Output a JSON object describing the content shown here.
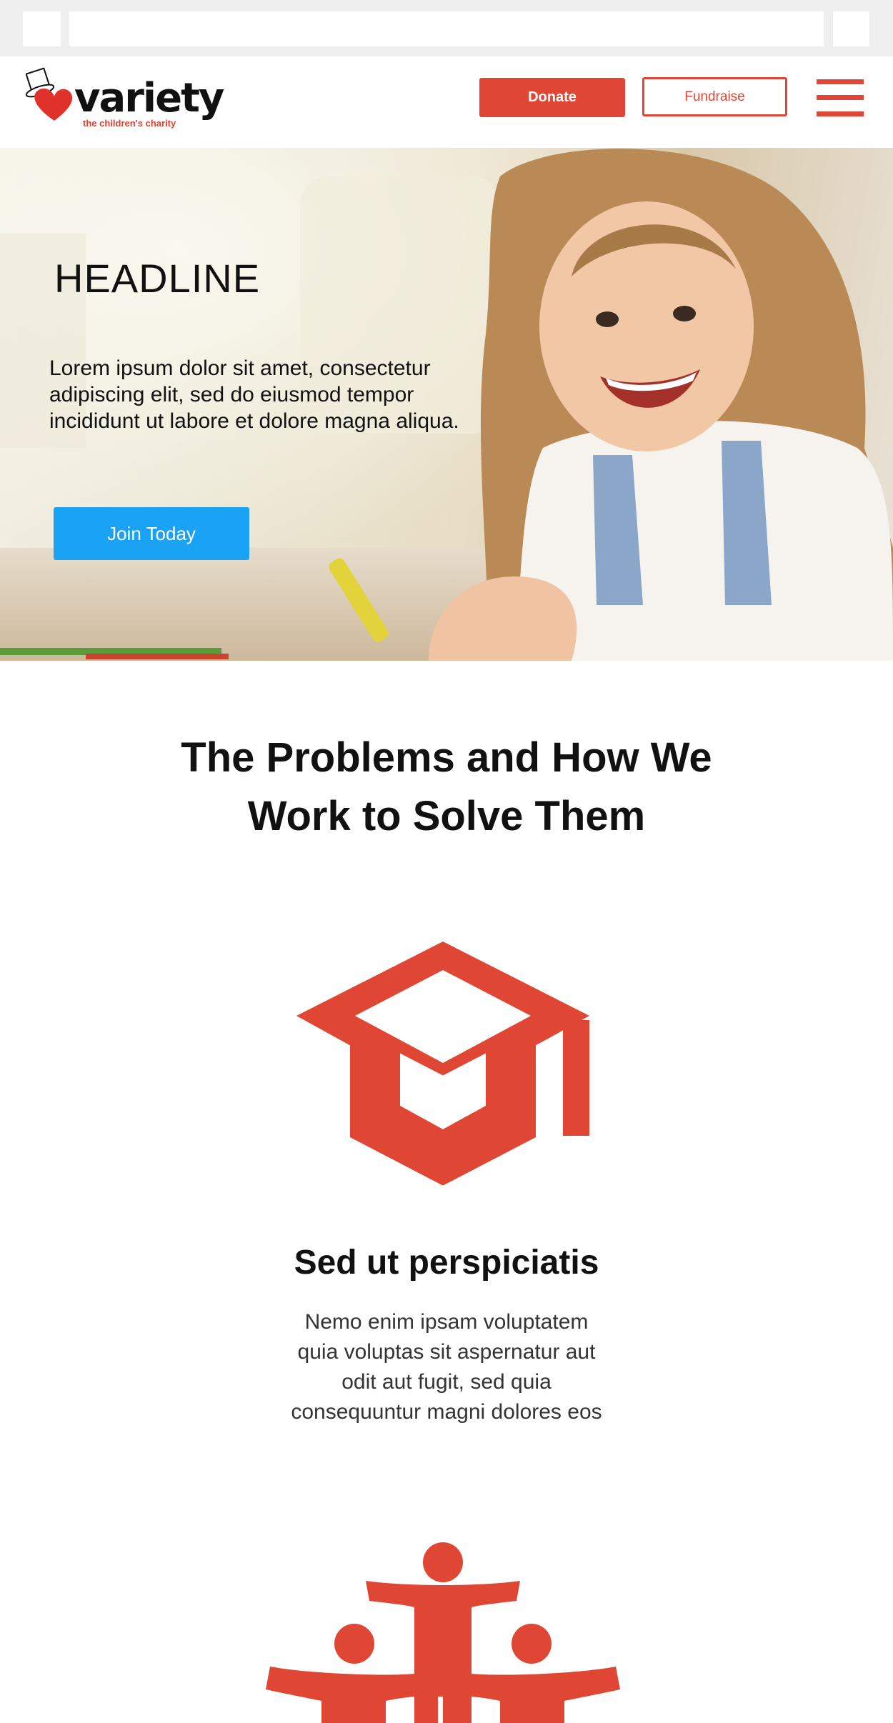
{
  "browser": {
    "url": ""
  },
  "header": {
    "logo_word": "variety",
    "logo_tagline": "the children's charity",
    "donate_label": "Donate",
    "fundraise_label": "Fundraise"
  },
  "hero": {
    "headline": "HEADLINE",
    "body": "Lorem ipsum dolor sit amet, consectetur adipiscing elit, sed do eiusmod tempor incididunt ut labore et dolore magna aliqua.",
    "cta_label": "Join Today"
  },
  "section": {
    "title": "The Problems and How We Work to Solve Them",
    "cards": [
      {
        "icon": "graduation-cap-icon",
        "title": "Sed ut perspiciatis",
        "body": "Nemo enim ipsam voluptatem quia voluptas sit aspernatur aut odit aut fugit, sed quia consequuntur magni dolores eos"
      },
      {
        "icon": "group-people-icon"
      }
    ]
  },
  "colors": {
    "brand_red": "#e04634",
    "cta_blue": "#1aa3f5"
  }
}
